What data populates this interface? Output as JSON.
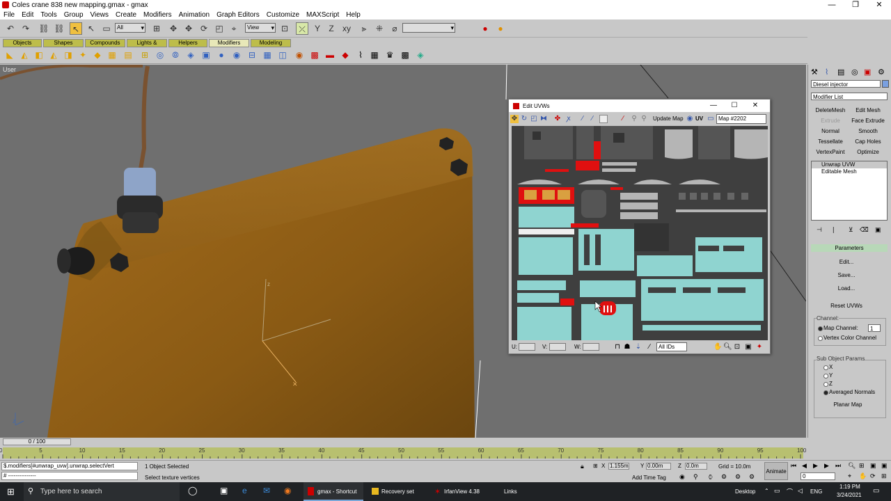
{
  "window": {
    "title": "Coles crane 838 new mapping.gmax - gmax",
    "min": "—",
    "max": "❐",
    "close": "✕"
  },
  "menu": [
    "File",
    "Edit",
    "Tools",
    "Group",
    "Views",
    "Create",
    "Modifiers",
    "Animation",
    "Graph Editors",
    "Customize",
    "MAXScript",
    "Help"
  ],
  "toolbar": {
    "selection_filter": "All",
    "ref_coord": "View",
    "named_selection": ""
  },
  "tabs": [
    "Objects",
    "Shapes",
    "Compounds",
    "Lights & Cameras",
    "Helpers",
    "Modifiers",
    "Modeling"
  ],
  "tabs_selected": "Modifiers",
  "viewport": {
    "label": "User"
  },
  "command_panel": {
    "object_name": "Diesel injector",
    "modifier_list": "Modifier List",
    "buttons": [
      "DeleteMesh",
      "Edit Mesh",
      "Extrude",
      "Face Extrude",
      "Normal",
      "Smooth",
      "Tessellate",
      "Cap Holes",
      "VertexPaint",
      "Optimize"
    ],
    "disabled_buttons": [
      "Extrude"
    ],
    "stack": [
      "Unwrap UVW",
      "Editable Mesh"
    ],
    "stack_selected": "Unwrap UVW",
    "parameters_title": "Parameters",
    "param_buttons": [
      "Edit...",
      "Save...",
      "Load..."
    ],
    "reset_uvws": "Reset UVWs",
    "channel_group": "Channel:",
    "map_channel_label": "Map Channel:",
    "map_channel_value": "1",
    "vertex_color_channel": "Vertex Color Channel",
    "subobj_group": "Sub Object Params",
    "subobj_options": [
      "X",
      "Y",
      "Z",
      "Averaged Normals"
    ],
    "subobj_selected": "Averaged Normals",
    "planar_map": "Planar Map"
  },
  "edit_uvws": {
    "title": "Edit UVWs",
    "update_map": "Update Map",
    "uv_label": "UV",
    "map_select": "Map #2202",
    "u_label": "U:",
    "v_label": "V:",
    "w_label": "W:",
    "ids_select": "All IDs"
  },
  "timeline": {
    "frame": "0 / 100",
    "ticks": [
      "0",
      "5",
      "10",
      "15",
      "20",
      "25",
      "30",
      "35",
      "40",
      "45",
      "50",
      "55",
      "60",
      "65",
      "70",
      "75",
      "80",
      "85",
      "90",
      "95",
      "100"
    ]
  },
  "status": {
    "maxscript": "$.modifiers[#unwrap_uvw].unwrap.selectVert",
    "maxscript2": "# ---------------",
    "selected": "1 Object Selected",
    "prompt": "Select texture vertices",
    "x": "1.155m",
    "y": "0.00m",
    "z": "0.0m",
    "grid": "Grid = 10.0m",
    "add_time_tag": "Add Time Tag",
    "animate": "Animate",
    "frame_field": "0"
  },
  "taskbar": {
    "search": "Type here to search",
    "items": [
      "gmax - Shortcut",
      "Recovery set",
      "IrfanView 4.38"
    ],
    "links": "Links",
    "desktop": "Desktop",
    "lang": "ENG",
    "time": "1:19 PM",
    "date": "3/24/2021"
  },
  "colors": {
    "uv_bg": "#3f3f3f",
    "uv_cyan": "#8fd4d0",
    "uv_red": "#e01010",
    "orange_panel": "#a06a1a",
    "viewport_bg": "#6f6f6f"
  }
}
